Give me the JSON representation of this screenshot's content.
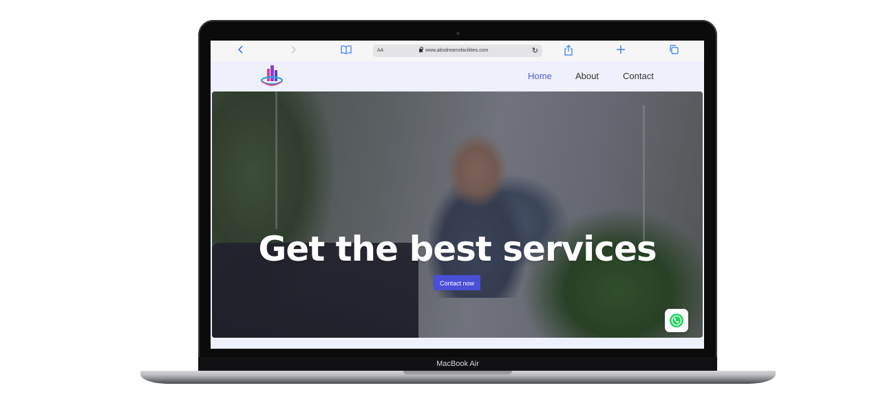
{
  "device": {
    "label": "MacBook Air"
  },
  "browser": {
    "text_size_label": "AA",
    "url": "www.absdreamsfacilities.com",
    "icons": [
      "back-icon",
      "forward-icon",
      "bookmarks-icon",
      "reload-icon",
      "share-icon",
      "new-tab-icon",
      "tabs-icon"
    ]
  },
  "site": {
    "nav": {
      "items": [
        {
          "label": "Home",
          "active": true
        },
        {
          "label": "About",
          "active": false
        },
        {
          "label": "Contact",
          "active": false
        }
      ]
    },
    "hero": {
      "title": "Get the best services",
      "cta_label": "Contact now"
    },
    "colors": {
      "accent": "#4a4fd8",
      "nav_active": "#4a5bd6",
      "whatsapp": "#25d366",
      "browser_icon": "#2f7cf6"
    }
  }
}
